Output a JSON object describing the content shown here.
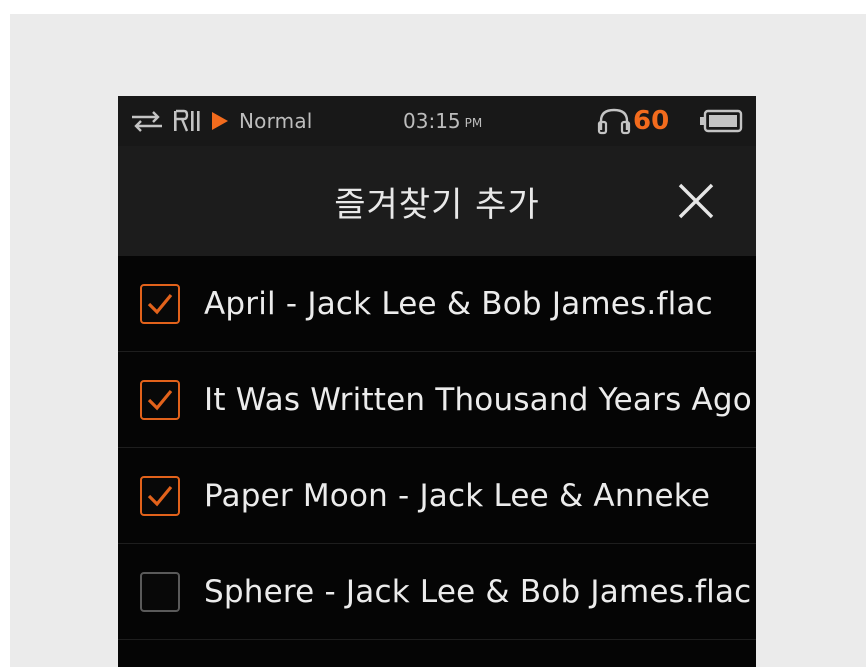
{
  "status_bar": {
    "play_mode": "Normal",
    "time": "03:15",
    "time_period": "PM",
    "volume": "60",
    "icons": [
      "repeat-icon",
      "shuffle-icon",
      "play-icon",
      "headphone-icon",
      "battery-icon"
    ]
  },
  "header": {
    "title": "즐겨찾기 추가",
    "close_icon": "close-icon"
  },
  "files": [
    {
      "name": "April - Jack Lee & Bob James.flac",
      "checked": true
    },
    {
      "name": "It Was Written Thousand Years Ago",
      "checked": true
    },
    {
      "name": "Paper Moon - Jack Lee & Anneke",
      "checked": true
    },
    {
      "name": "Sphere - Jack Lee & Bob James.flac",
      "checked": false
    }
  ],
  "colors": {
    "accent": "#f26b1d",
    "checkbox_checked": "#e2621b",
    "checkbox_unchecked": "#5a5a5a",
    "background": "#050505",
    "header_background": "#1c1c1c",
    "status_background": "#181818",
    "page_background": "#ebebeb"
  }
}
